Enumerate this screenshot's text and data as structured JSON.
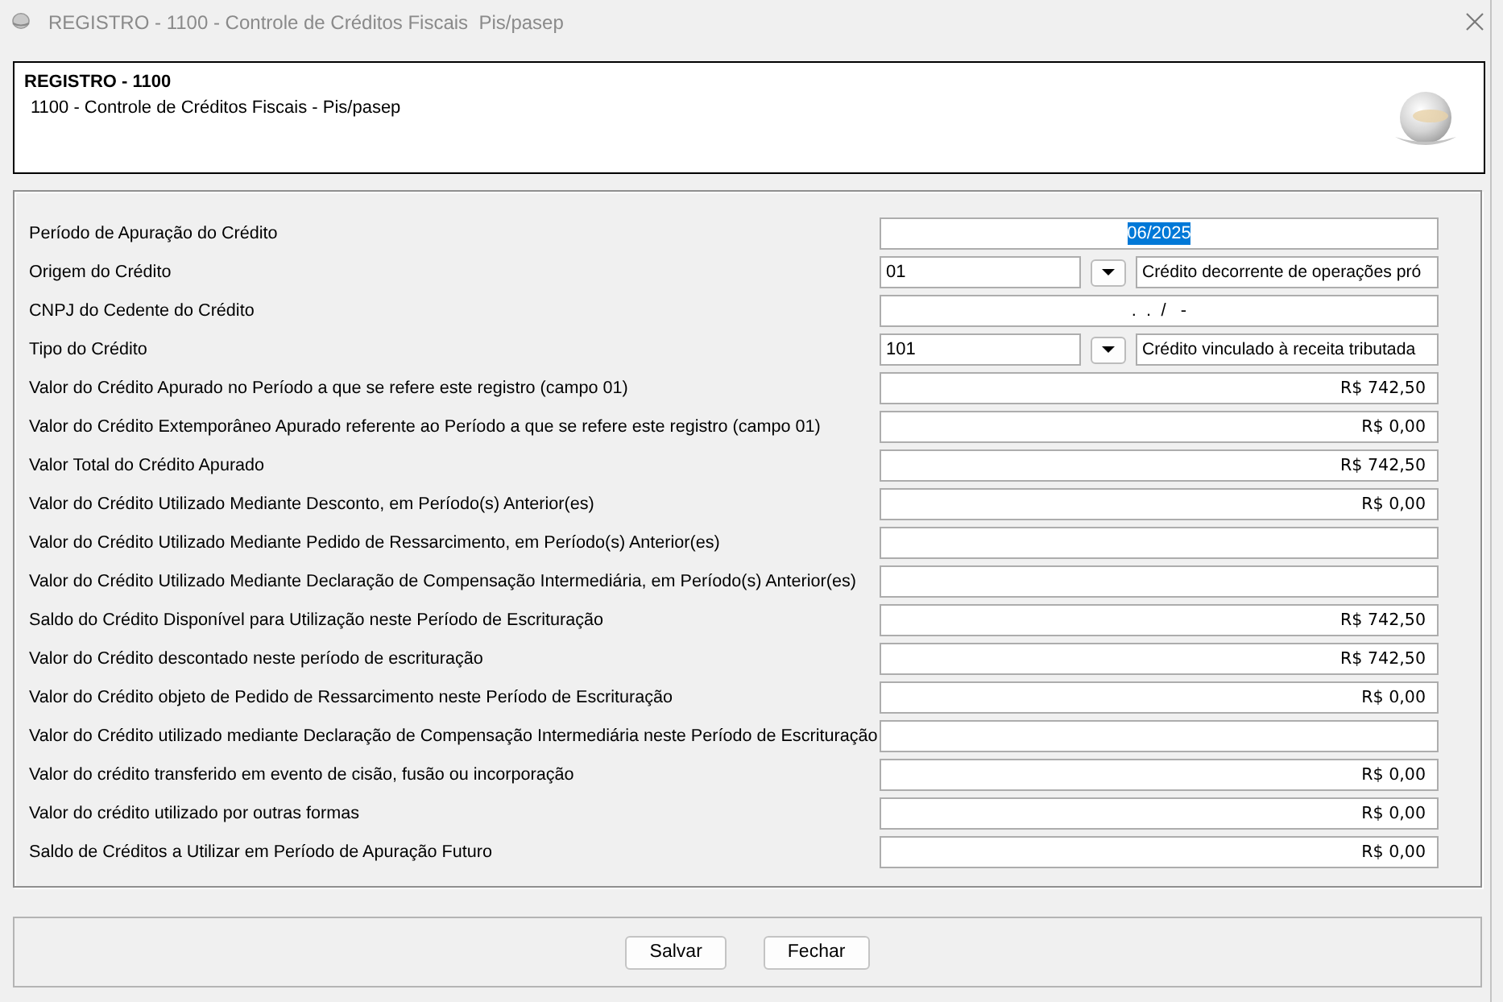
{
  "window": {
    "title": "REGISTRO - 1100 - Controle de Créditos Fiscais  Pis/pasep"
  },
  "header": {
    "title": "REGISTRO - 1100",
    "subtitle": "1100 - Controle de Créditos Fiscais - Pis/pasep"
  },
  "fields": [
    {
      "kind": "centered",
      "label": "Período de Apuração do Crédito",
      "value": "06/2025",
      "value_selected": true
    },
    {
      "kind": "combo",
      "label": "Origem do Crédito",
      "code": "01",
      "description": "Crédito decorrente de operações pró"
    },
    {
      "kind": "centered",
      "label": "CNPJ do Cedente do Crédito",
      "value": ".  .  /   -",
      "value_selected": false
    },
    {
      "kind": "combo",
      "label": "Tipo do Crédito",
      "code": "101",
      "description": "Crédito vinculado à receita tributada"
    },
    {
      "kind": "money",
      "label": "Valor do Crédito Apurado no Período a que se refere este registro (campo 01)",
      "value": "R$ 742,50"
    },
    {
      "kind": "money",
      "label": "Valor do Crédito Extemporâneo Apurado referente ao Período a que se refere este registro (campo 01)",
      "value": "R$ 0,00"
    },
    {
      "kind": "money",
      "label": "Valor Total do Crédito Apurado",
      "value": "R$ 742,50"
    },
    {
      "kind": "money",
      "label": "Valor do Crédito Utilizado Mediante Desconto, em Período(s) Anterior(es)",
      "value": "R$ 0,00"
    },
    {
      "kind": "money",
      "label": "Valor do Crédito Utilizado Mediante Pedido de Ressarcimento, em Período(s) Anterior(es)"
    },
    {
      "kind": "money",
      "label": "Valor do Crédito Utilizado Mediante Declaração de Compensação Intermediária, em Período(s) Anterior(es)"
    },
    {
      "kind": "money",
      "label": "Saldo do Crédito Disponível para Utilização neste Período de Escrituração",
      "value": "R$ 742,50"
    },
    {
      "kind": "money",
      "label": "Valor do Crédito descontado neste período de escrituração",
      "value": "R$ 742,50"
    },
    {
      "kind": "money",
      "label": "Valor do Crédito objeto de Pedido de Ressarcimento neste Período de Escrituração",
      "value": "R$ 0,00"
    },
    {
      "kind": "money",
      "label": "Valor do Crédito utilizado mediante Declaração de Compensação Intermediária neste Período de Escrituração"
    },
    {
      "kind": "money",
      "label": "Valor do crédito transferido em evento de cisão, fusão ou incorporação",
      "value": "R$ 0,00"
    },
    {
      "kind": "money",
      "label": "Valor do crédito utilizado por outras formas",
      "value": "R$ 0,00"
    },
    {
      "kind": "money",
      "label": "Saldo de Créditos a Utilizar em Período de Apuração Futuro",
      "value": "R$ 0,00"
    }
  ],
  "buttons": [
    "Salvar",
    "Fechar"
  ]
}
